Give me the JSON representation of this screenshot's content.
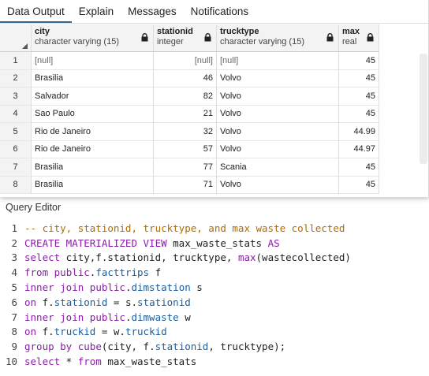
{
  "tabs": [
    "Data Output",
    "Explain",
    "Messages",
    "Notifications"
  ],
  "active_tab": 0,
  "columns": [
    {
      "name": "city",
      "type": "character varying (15)"
    },
    {
      "name": "stationid",
      "type": "integer"
    },
    {
      "name": "trucktype",
      "type": "character varying (15)"
    },
    {
      "name": "max",
      "type": "real"
    }
  ],
  "rows": [
    {
      "num": "1",
      "city": "[null]",
      "stationid": "[null]",
      "trucktype": "[null]",
      "max": "45"
    },
    {
      "num": "2",
      "city": "Brasilia",
      "stationid": "46",
      "trucktype": "Volvo",
      "max": "45"
    },
    {
      "num": "3",
      "city": "Salvador",
      "stationid": "82",
      "trucktype": "Volvo",
      "max": "45"
    },
    {
      "num": "4",
      "city": "Sao Paulo",
      "stationid": "21",
      "trucktype": "Volvo",
      "max": "45"
    },
    {
      "num": "5",
      "city": "Rio de Janeiro",
      "stationid": "32",
      "trucktype": "Volvo",
      "max": "44.99"
    },
    {
      "num": "6",
      "city": "Rio de Janeiro",
      "stationid": "57",
      "trucktype": "Volvo",
      "max": "44.97"
    },
    {
      "num": "7",
      "city": "Brasilia",
      "stationid": "77",
      "trucktype": "Scania",
      "max": "45"
    },
    {
      "num": "8",
      "city": "Brasilia",
      "stationid": "71",
      "trucktype": "Volvo",
      "max": "45"
    }
  ],
  "query_editor": {
    "title": "Query Editor",
    "lines": [
      {
        "num": "1",
        "tokens": [
          {
            "t": "-- city, stationid, trucktype, and max waste collected",
            "c": "cm"
          }
        ]
      },
      {
        "num": "2",
        "tokens": [
          {
            "t": "CREATE MATERIALIZED VIEW",
            "c": "kw"
          },
          {
            "t": " max_waste_stats ",
            "c": "plain"
          },
          {
            "t": "AS",
            "c": "kw"
          }
        ]
      },
      {
        "num": "3",
        "tokens": [
          {
            "t": "select",
            "c": "kw"
          },
          {
            "t": " city,f.stationid, trucktype, ",
            "c": "plain"
          },
          {
            "t": "max",
            "c": "fn"
          },
          {
            "t": "(wastecollected)",
            "c": "plain"
          }
        ]
      },
      {
        "num": "4",
        "tokens": [
          {
            "t": "from",
            "c": "kw"
          },
          {
            "t": " ",
            "c": "plain"
          },
          {
            "t": "public",
            "c": "kw"
          },
          {
            "t": ".",
            "c": "plain"
          },
          {
            "t": "facttrips",
            "c": "prop"
          },
          {
            "t": " f",
            "c": "plain"
          }
        ]
      },
      {
        "num": "5",
        "tokens": [
          {
            "t": "inner join",
            "c": "kw"
          },
          {
            "t": " ",
            "c": "plain"
          },
          {
            "t": "public",
            "c": "kw"
          },
          {
            "t": ".",
            "c": "plain"
          },
          {
            "t": "dimstation",
            "c": "prop"
          },
          {
            "t": " s",
            "c": "plain"
          }
        ]
      },
      {
        "num": "6",
        "tokens": [
          {
            "t": "on",
            "c": "kw"
          },
          {
            "t": " f.",
            "c": "plain"
          },
          {
            "t": "stationid",
            "c": "prop"
          },
          {
            "t": " = s.",
            "c": "plain"
          },
          {
            "t": "stationid",
            "c": "prop"
          }
        ]
      },
      {
        "num": "7",
        "tokens": [
          {
            "t": "inner join",
            "c": "kw"
          },
          {
            "t": " ",
            "c": "plain"
          },
          {
            "t": "public",
            "c": "kw"
          },
          {
            "t": ".",
            "c": "plain"
          },
          {
            "t": "dimwaste",
            "c": "prop"
          },
          {
            "t": " w",
            "c": "plain"
          }
        ]
      },
      {
        "num": "8",
        "tokens": [
          {
            "t": "on",
            "c": "kw"
          },
          {
            "t": " f.",
            "c": "plain"
          },
          {
            "t": "truckid",
            "c": "prop"
          },
          {
            "t": " = w.",
            "c": "plain"
          },
          {
            "t": "truckid",
            "c": "prop"
          }
        ]
      },
      {
        "num": "9",
        "tokens": [
          {
            "t": "group by",
            "c": "kw"
          },
          {
            "t": " ",
            "c": "plain"
          },
          {
            "t": "cube",
            "c": "fn"
          },
          {
            "t": "(city, f.",
            "c": "plain"
          },
          {
            "t": "stationid",
            "c": "prop"
          },
          {
            "t": ", trucktype);",
            "c": "plain"
          }
        ]
      },
      {
        "num": "10",
        "tokens": [
          {
            "t": "select",
            "c": "kw"
          },
          {
            "t": " * ",
            "c": "plain"
          },
          {
            "t": "from",
            "c": "kw"
          },
          {
            "t": " max_waste_stats",
            "c": "plain"
          }
        ]
      }
    ]
  }
}
